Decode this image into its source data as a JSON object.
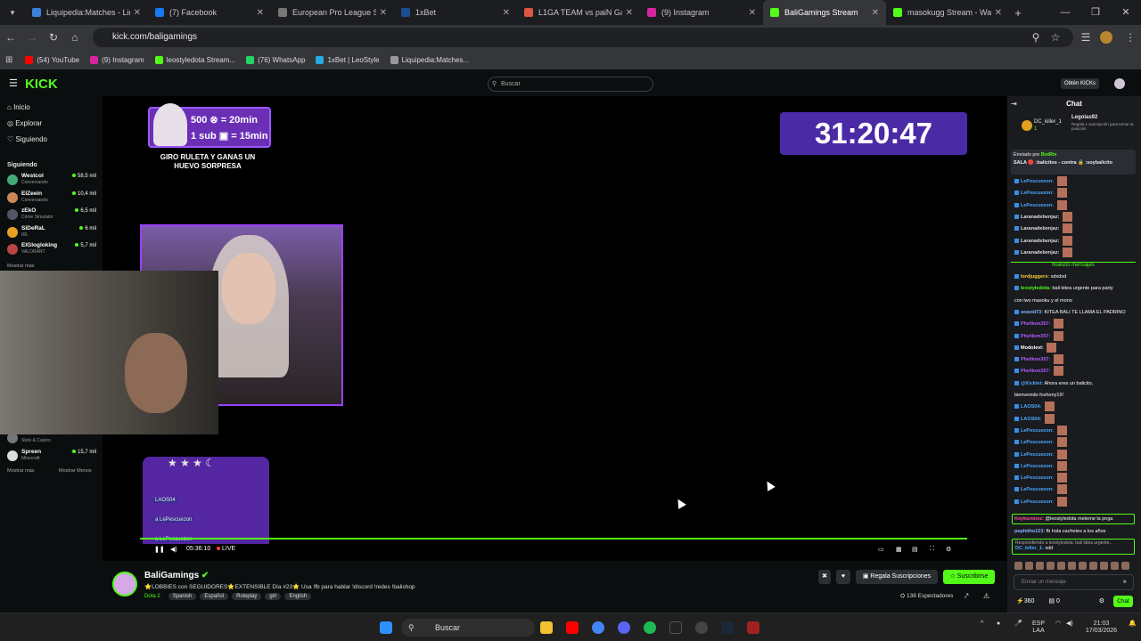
{
  "browser": {
    "tabs": [
      {
        "label": "Liquipedia:Matches - Liqu",
        "color": "#3b7fd6"
      },
      {
        "label": "(7) Facebook",
        "color": "#1877f2"
      },
      {
        "label": "European Pro League Sea",
        "color": "#777"
      },
      {
        "label": "1xBet",
        "color": "#1b4f8f"
      },
      {
        "label": "L1GA TEAM vs paiN Gami",
        "color": "#d54"
      },
      {
        "label": "(9) Instagram",
        "color": "#d6249f"
      },
      {
        "label": "BaliGamings Stream",
        "color": "#53fc18"
      },
      {
        "label": "masokugg Stream - Wate",
        "color": "#53fc18"
      }
    ],
    "new_tab": "+",
    "url": "kick.com/baligamings",
    "bookmarks": [
      {
        "label": "(54) YouTube",
        "color": "#ff0000"
      },
      {
        "label": "(9) Instagram",
        "color": "#d6249f"
      },
      {
        "label": "leostyledota Stream...",
        "color": "#53fc18"
      },
      {
        "label": "(76) WhatsApp",
        "color": "#25d366"
      },
      {
        "label": "1xBet | LeoStyle",
        "color": "#29a9e1"
      },
      {
        "label": "Liquipedia:Matches...",
        "color": "#999"
      }
    ]
  },
  "kick": {
    "logo": "KICK",
    "search_placeholder": "Buscar",
    "get_kicks": "Obtén KICKs",
    "nav": [
      "Inicio",
      "Explorar",
      "Siguiendo"
    ],
    "following_header": "Siguiendo",
    "following": [
      {
        "name": "Westcol",
        "category": "Conversando",
        "viewers": "58,5 mil",
        "color": "#4a7"
      },
      {
        "name": "ElZeein",
        "category": "Conversando",
        "viewers": "10,4 mil",
        "color": "#c85"
      },
      {
        "name": "zEkO",
        "category": "Crime Simulator",
        "viewers": "6,5 mil",
        "color": "#556"
      },
      {
        "name": "SiDeRaL",
        "category": "IRL",
        "viewers": "6 mil",
        "color": "#e8a020"
      },
      {
        "name": "ElGlogloking",
        "category": "VALORANT",
        "viewers": "5,7 mil",
        "color": "#b44"
      }
    ],
    "following_lower": [
      {
        "name": "",
        "category": "Slots & Casino",
        "viewers": "",
        "color": "#777"
      },
      {
        "name": "Spreen",
        "category": "Minecraft",
        "viewers": "15,7 mil",
        "color": "#ddd"
      }
    ],
    "show_more": "Mostrar más",
    "show_less": "Mostrar Menos"
  },
  "stream": {
    "overlay_kicks": "500",
    "overlay_kicks_suffix": "= 20min",
    "overlay_subs": "1 sub",
    "overlay_subs_suffix": "= 15min",
    "overlay_caption": "GIRO RULETA Y GANAS UN HUEVO SORPRESA",
    "timer": "31:20:47",
    "overlay_chat": [
      "LAOS04",
      "a LePescuezon",
      "a LePescuezon"
    ],
    "elapsed": "05:36:10",
    "live": "LIVE",
    "progress_fraction": 1.0
  },
  "channel": {
    "name": "BaliGamings",
    "title": "⭐LOBBIES con SEGUIDORES⭐EXTENSIBLE Día #23⭐ Usa !fb para hablar !discord !redes !balishop",
    "game": "Dota 2",
    "tags": [
      "Spanish",
      "Español",
      "Roleplay",
      "girl",
      "English"
    ],
    "gift_label": "Regala Suscripciones",
    "subscribe_label": "Suscribirse",
    "viewers": "138 Espectadores"
  },
  "chat": {
    "header": "Chat",
    "gifter_name": "DC_killer_1",
    "gifter_count": "1",
    "gift_info_name": "Legolas92",
    "gift_info": "Regala 1 suscripción para tomar la posición",
    "pinned_by": "Enviado por",
    "pinned_user": "BotRix",
    "pinned_text": "SALA 🔴 :balicitos - contra 🔒 :soybalicito",
    "messages_top": [
      {
        "user": "LePescuezon:",
        "text": "",
        "color": "#4aa8ff",
        "emote": true
      },
      {
        "user": "LePescuezon:",
        "text": "",
        "color": "#4aa8ff",
        "emote": true
      },
      {
        "user": "LePescuezon:",
        "text": "",
        "color": "#4aa8ff",
        "emote": true
      },
      {
        "user": "Laranadebenjaz:",
        "text": "",
        "color": "#ddd",
        "emote": true
      },
      {
        "user": "Laranadebenjaz:",
        "text": "",
        "color": "#ddd",
        "emote": true
      },
      {
        "user": "Laranadebenjaz:",
        "text": "",
        "color": "#ddd",
        "emote": true
      },
      {
        "user": "Laranadebenjaz:",
        "text": "",
        "color": "#ddd",
        "emote": true
      }
    ],
    "new_messages": "Nuevos mensajes",
    "messages": [
      {
        "user": "lordjuggers:",
        "text": "xdxdxd",
        "color": "#ffcc33",
        "emote": false
      },
      {
        "user": "leostyledota:",
        "text": "bali kitea urgente para party",
        "color": "#53fc18",
        "emote": false
      },
      {
        "user": "",
        "text": "con lwo masoku y el mono",
        "color": "#ddd",
        "emote": false
      },
      {
        "user": "seavid73:",
        "text": "KITEA BALI TE LLAMA EL PADRINO",
        "color": "#8ab4ff",
        "emote": false
      },
      {
        "user": "PheNom357:",
        "text": "",
        "color": "#b05cff",
        "emote": true
      },
      {
        "user": "PheNom357:",
        "text": "",
        "color": "#b05cff",
        "emote": true
      },
      {
        "user": "Modolevi:",
        "text": "",
        "color": "#fff",
        "emote": true
      },
      {
        "user": "PheNom357:",
        "text": "",
        "color": "#b05cff",
        "emote": true
      },
      {
        "user": "PheNom357:",
        "text": "",
        "color": "#b05cff",
        "emote": true
      },
      {
        "user": "@Kicklet:",
        "text": "Ahora eres un balicito,",
        "color": "#4aa8ff",
        "emote": false
      },
      {
        "user": "",
        "text": "bienvenido foxhony19!",
        "color": "#ddd",
        "emote": false
      },
      {
        "user": "LAOS04:",
        "text": "",
        "color": "#4aa8ff",
        "emote": true
      },
      {
        "user": "LAOS04:",
        "text": "",
        "color": "#4aa8ff",
        "emote": true
      },
      {
        "user": "LePescuezon:",
        "text": "",
        "color": "#4aa8ff",
        "emote": true
      },
      {
        "user": "LePescuezon:",
        "text": "",
        "color": "#4aa8ff",
        "emote": true
      },
      {
        "user": "LePescuezon:",
        "text": "",
        "color": "#4aa8ff",
        "emote": true
      },
      {
        "user": "LePescuezon:",
        "text": "",
        "color": "#4aa8ff",
        "emote": true
      },
      {
        "user": "LePescuezon:",
        "text": "",
        "color": "#4aa8ff",
        "emote": true
      },
      {
        "user": "LePescuezon:",
        "text": "",
        "color": "#4aa8ff",
        "emote": true
      },
      {
        "user": "LePescuezon:",
        "text": "",
        "color": "#4aa8ff",
        "emote": true
      }
    ],
    "highlight_user": "Keykuronez:",
    "highlight_text": "@leostyledota meteme la pnga",
    "last_user": "pephitho123:",
    "last_text": "fb hola cachetes a los años",
    "reply_to": "Respondiendo a leostyledota: bali kitea urgente...",
    "reply_user": "DC_killer_1:",
    "reply_text": "xdd",
    "input_placeholder": "Enviar un mensaje",
    "points": "360",
    "kicks": "0",
    "send_label": "Chat"
  },
  "taskbar": {
    "search": "Buscar",
    "lang": "ESP",
    "lang2": "LAA",
    "time": "21:03",
    "date": "17/03/2026"
  }
}
